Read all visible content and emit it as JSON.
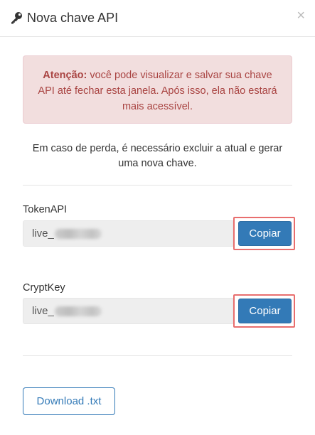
{
  "modal": {
    "title": "Nova chave API",
    "close_label": "×"
  },
  "alert": {
    "strong": "Atenção:",
    "text": " você pode visualizar e salvar sua chave API até fechar esta janela. Após isso, ela não estará mais acessível."
  },
  "info_text": "Em caso de perda, é necessário excluir a atual e gerar uma nova chave.",
  "fields": [
    {
      "label": "TokenAPI",
      "value_prefix": "live_",
      "button_label": "Copiar"
    },
    {
      "label": "CryptKey",
      "value_prefix": "live_",
      "button_label": "Copiar"
    }
  ],
  "download_label": "Download .txt",
  "colors": {
    "primary": "#337ab7",
    "alert_bg": "#f2dede",
    "alert_text": "#a94442",
    "highlight": "#e86e6e"
  }
}
